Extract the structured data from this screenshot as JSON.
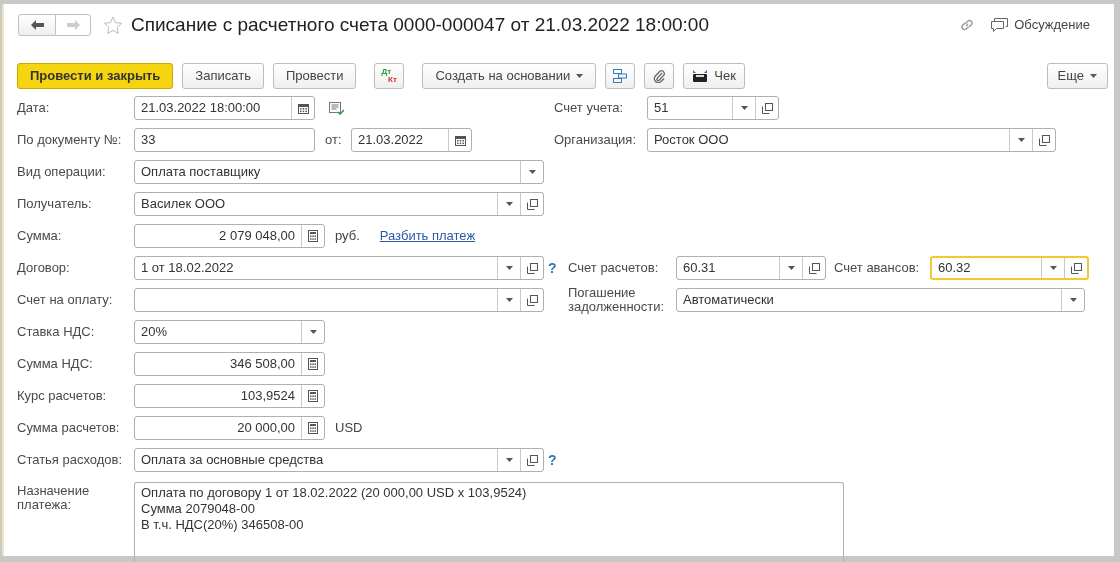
{
  "header": {
    "title": "Списание с расчетного счета 0000-000047 от 21.03.2022 18:00:00",
    "back_enabled": true,
    "forward_enabled": false,
    "discussion": "Обсуждение"
  },
  "toolbar": {
    "buttons": [
      {
        "kind": "primary",
        "label": "Провести и закрыть"
      },
      {
        "kind": "plain",
        "label": "Записать"
      },
      {
        "kind": "plain",
        "label": "Провести"
      },
      {
        "kind": "dtkt",
        "top": "Дт",
        "bottom": "Кт"
      },
      {
        "kind": "menu",
        "label": "Создать на основании"
      },
      {
        "kind": "structure"
      },
      {
        "kind": "attach"
      },
      {
        "kind": "receipt",
        "label": "Чек"
      }
    ],
    "more": "Еще"
  },
  "form": {
    "date": {
      "label": "Дата:",
      "value": "21.03.2022 18:00:00"
    },
    "account": {
      "label": "Счет учета:",
      "value": "51"
    },
    "doc_number": {
      "label": "По документу №:",
      "value": "33"
    },
    "doc_from": {
      "label": "от:",
      "value": "21.03.2022"
    },
    "organization": {
      "label": "Организация:",
      "value": "Росток ООО"
    },
    "operation": {
      "label": "Вид операции:",
      "value": "Оплата поставщику"
    },
    "recipient": {
      "label": "Получатель:",
      "value": "Василек ООО"
    },
    "amount": {
      "label": "Сумма:",
      "value": "2 079 048,00",
      "currency": "руб.",
      "link": "Разбить платеж"
    },
    "contract": {
      "label": "Договор:",
      "value": "1 от 18.02.2022",
      "help": "?"
    },
    "settlement_account": {
      "label": "Счет расчетов:",
      "value": "60.31"
    },
    "advance_account": {
      "label": "Счет авансов:",
      "value": "60.32",
      "focused": true
    },
    "invoice": {
      "label": "Счет на оплату:"
    },
    "repayment": {
      "label": "Погашение задолженности:",
      "value": "Автоматически"
    },
    "vat_rate": {
      "label": "Ставка НДС:",
      "value": "20%"
    },
    "vat_amount": {
      "label": "Сумма НДС:",
      "value": "346 508,00"
    },
    "rate": {
      "label": "Курс расчетов:",
      "value": "103,9524"
    },
    "settlement_amount": {
      "label": "Сумма расчетов:",
      "value": "20 000,00",
      "currency": "USD"
    },
    "expense_item": {
      "label": "Статья расходов:",
      "value": "Оплата за основные средства",
      "help": "?"
    },
    "purpose": {
      "label": "Назначение платежа:",
      "lines": [
        "Оплата по договору 1 от 18.02.2022 (20 000,00 USD x 103,9524)",
        "Сумма 2079048-00",
        "В т.ч. НДС(20%) 346508-00"
      ]
    }
  }
}
